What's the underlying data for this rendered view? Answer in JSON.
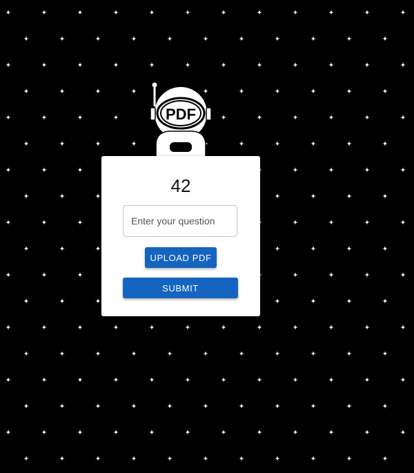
{
  "mascot": {
    "badge_text": "PDF"
  },
  "card": {
    "answer": "42",
    "question_placeholder": "Enter your question",
    "question_value": "",
    "upload_label": "UPLOAD PDF",
    "submit_label": "SUBMIT"
  },
  "colors": {
    "background": "#000000",
    "card": "#ffffff",
    "primary_button": "#1565c0",
    "star": "#ffffff"
  },
  "icons": {
    "background": "star-icon",
    "mascot": "astronaut-icon"
  }
}
